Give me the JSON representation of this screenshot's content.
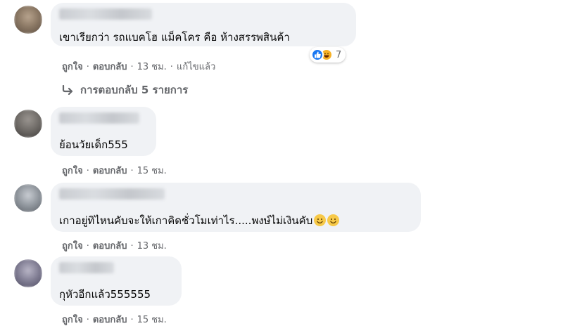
{
  "comments": [
    {
      "text": "เขาเรียกว่า รถแบคโฮ แม็คโคร คือ ห้างสรรพสินค้า",
      "like": "ถูกใจ",
      "reply": "ตอบกลับ",
      "time": "13 ชม.",
      "edited": "แก้ไขแล้ว",
      "reaction_count": "7",
      "reactions": [
        "like-icon",
        "haha-icon"
      ],
      "replies_label": "การตอบกลับ 5 รายการ"
    },
    {
      "text": "ย้อนวัยเด็ก555",
      "like": "ถูกใจ",
      "reply": "ตอบกลับ",
      "time": "15 ชม."
    },
    {
      "text": "เกาอยู่ทิไหนคับจะให้เกาคิดชั่วโมเท่าไร.....พงษ์ไม่เงินคับ",
      "emojis": [
        "smile-emoji",
        "smile-emoji"
      ],
      "like": "ถูกใจ",
      "reply": "ตอบกลับ",
      "time": "13 ชม."
    },
    {
      "text": "กุหัวอีกแล้ว555555",
      "like": "ถูกใจ",
      "reply": "ตอบกลับ",
      "time": "15 ชม."
    }
  ],
  "colors": {
    "bubble": "#f0f2f5",
    "meta_text": "#65676b",
    "like_blue": "#1877f2",
    "haha_yellow": "#f7b125"
  }
}
